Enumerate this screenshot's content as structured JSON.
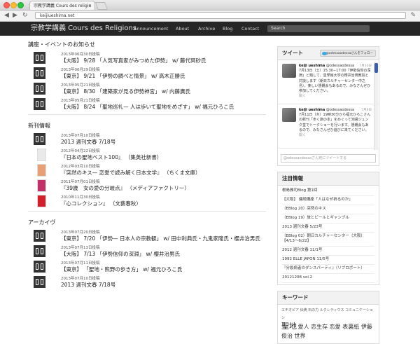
{
  "browser": {
    "tab_title": "宗教学講義 Cours des religio",
    "tab_close": "×",
    "url": "keijiueshima.net",
    "back": "◀",
    "forward": "▶",
    "reload": "↻",
    "wrench": "✎"
  },
  "nav": {
    "brand": "宗教学講義 Cours des Religions",
    "items": [
      "Announcement",
      "About",
      "Archive",
      "Blog",
      "Contact"
    ],
    "search_placeholder": "Search"
  },
  "lectures": {
    "title": "講座・イベントのお知らせ",
    "items": [
      {
        "date": "2013年06月30日投稿",
        "title": "【大阪】 9/28 「人気写真家がみつめた伊勢」 w/ 藤代冥砂氏"
      },
      {
        "date": "2013年06月29日投稿",
        "title": "【東京】 9/21 「伊勢の調べと情景」 w/ 高木正勝氏"
      },
      {
        "date": "2013年05月21日投稿",
        "title": "【東京】 8/30 「建築家が見る伊勢神宮」 w/ 内藤廣氏"
      },
      {
        "date": "2013年05月21日投稿",
        "title": "【大阪】 8/24 「聖地巡礼— 人は歩いて聖地をめざす」 w/ 福元ひろこ氏"
      }
    ]
  },
  "publications": {
    "title": "新刊情報",
    "items": [
      {
        "date": "2013年07月10日投稿",
        "title": "2013 週刊文春 7/18号",
        "thumb": "icon"
      },
      {
        "date": "2012年04月22日投稿",
        "title": "『日本の聖地ベスト100』 （集英社新書）",
        "thumb": "#e9e9e9"
      },
      {
        "date": "2012年03月10日投稿",
        "title": "『突然のキス— 恋愛で読み解く日本文学』 （ちくま文庫）",
        "thumb": "#e7a073"
      },
      {
        "date": "2011年07月01日投稿",
        "title": "『39歳　女の愛の分岐点』 （メディアファクトリー）",
        "thumb": "#c2306a"
      },
      {
        "date": "2010年11月30日投稿",
        "title": "『心コレクション』 （文藝春秋）",
        "thumb": "#d21f2a"
      }
    ]
  },
  "archive": {
    "title": "アーカイヴ",
    "items": [
      {
        "date": "2013年07月20日投稿",
        "title": "【東京】 7/20 「伊勢— 日本人の宗教観」 w/ 田中利典氏・九鬼家隆氏・櫻井治男氏"
      },
      {
        "date": "2013年07月13日投稿",
        "title": "【大阪】 7/13 「伊勢信仰の深淵」 w/ 櫻井治男氏"
      },
      {
        "date": "2013年07月11日投稿",
        "title": "【東京】 「聖地・熊野の歩き方」 w/ 福元ひろこ氏"
      },
      {
        "date": "2013年07月10日投稿",
        "title": "2013 週刊文春 7/18号"
      }
    ]
  },
  "tweets": {
    "title": "ツイート",
    "follow_label": "@odessaodessaさんをフォロー",
    "items": [
      {
        "user": "keiji ueshima",
        "handle": "@odessaodessa",
        "date": "7月10日",
        "text": "7月13日（土）15:30−17:00「伊勢信仰の深淵」と題して、皇學館大学の櫻井治男教授と対談します（朝日カルチャーセンター中之島）。楽しい懇親会もあるので、みなさんぜひ参加してください。",
        "more": "開く"
      },
      {
        "user": "keiji ueshima",
        "handle": "@odessaodessa",
        "date": "7月6日",
        "text": "7月11日（木）19時30分から福元ひろこさんの新刊「歩く旅の本」をめぐって池袋ジュンク堂でトークショーを行います。懇親会もあるので、みなさんぜひ遊びに来てください。",
        "more": "開く"
      }
    ],
    "input_placeholder": "@odessaodessaさん宛にツイートする"
  },
  "noted": {
    "title": "注目情報",
    "items": [
      "根島雅司Blog 第1回",
      "【大阪】 連続講座「人はなぜ祈るのか」",
      "（EBlog 20）突然のキス",
      "（EBlog 19）旅とビールとギャンブル",
      "2013 週刊文春 5/23号",
      "（EBlog 02）朝日カルチャーセンター（大阪）【4/13〜6/22】",
      "2012 週刊文春 11/1号",
      "1992 ELLE JAPON 11/5号",
      "『分裂病者のダンスパーティ』（リブロポート）",
      "20121208 vol.2"
    ]
  },
  "keywords": {
    "title": "キーワード",
    "line1": "エチオピア 伝統 石の力 ルクレティウス コミュニケーション",
    "big": "聖地",
    "line2": "愛人 恋生存 恋愛 表裏紙 伊藤俊治 世界"
  },
  "colors": {
    "nav_bg": "#262626",
    "accent": "#3b5ea8"
  }
}
